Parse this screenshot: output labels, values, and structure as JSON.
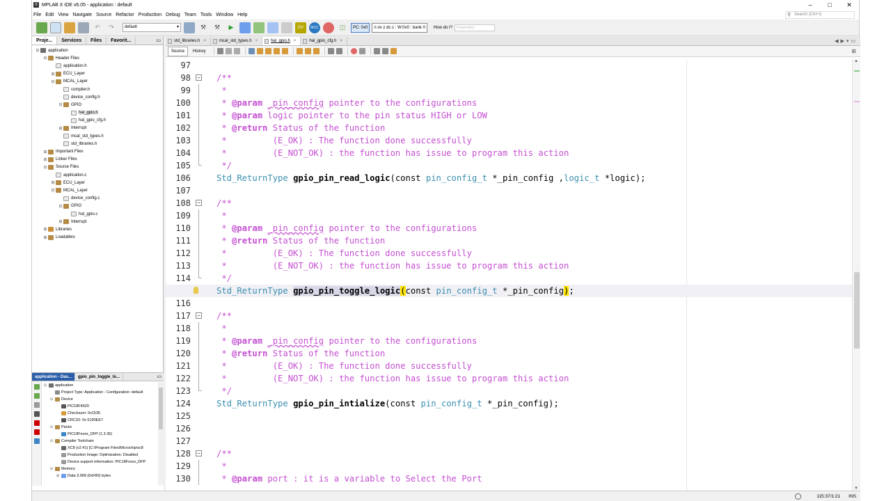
{
  "window": {
    "title": "MPLAB X IDE v6.05 - application : default",
    "controls": [
      "–",
      "□",
      "✕"
    ]
  },
  "menu": {
    "items": [
      "File",
      "Edit",
      "View",
      "Navigate",
      "Source",
      "Refactor",
      "Production",
      "Debug",
      "Team",
      "Tools",
      "Window",
      "Help"
    ],
    "search_placeholder": "Search (Ctrl+I)"
  },
  "toolbar": {
    "configuration": "default",
    "pc": "PC: 0x0",
    "status_bits": "n ov z dc c : W:0x0 : bank 0",
    "how_do_i": "How do I?",
    "keyword_placeholder": "Keyword(s)"
  },
  "left_panel": {
    "tabs": [
      "Proje...",
      "Services",
      "Files",
      "Favorit..."
    ],
    "tree": [
      {
        "depth": 0,
        "toggle": "⊟",
        "icon": "proj",
        "label": "application"
      },
      {
        "depth": 1,
        "toggle": "⊟",
        "icon": "folder",
        "label": "Header Files"
      },
      {
        "depth": 2,
        "toggle": "",
        "icon": "file-h",
        "label": "application.h"
      },
      {
        "depth": 2,
        "toggle": "⊞",
        "icon": "folder",
        "label": "ECU_Layer"
      },
      {
        "depth": 2,
        "toggle": "⊟",
        "icon": "folder",
        "label": "MCAL_Layer"
      },
      {
        "depth": 3,
        "toggle": "",
        "icon": "file-h",
        "label": "compiler.h"
      },
      {
        "depth": 3,
        "toggle": "",
        "icon": "file-h",
        "label": "device_config.h"
      },
      {
        "depth": 3,
        "toggle": "⊟",
        "icon": "folder",
        "label": "GPIO"
      },
      {
        "depth": 4,
        "toggle": "",
        "icon": "file-h",
        "label": "hal_gpio.h",
        "selected": true
      },
      {
        "depth": 4,
        "toggle": "",
        "icon": "file-h",
        "label": "hal_gpio_cfg.h"
      },
      {
        "depth": 3,
        "toggle": "⊞",
        "icon": "folder",
        "label": "Interrupt"
      },
      {
        "depth": 3,
        "toggle": "",
        "icon": "file-h",
        "label": "mcal_std_types.h"
      },
      {
        "depth": 3,
        "toggle": "",
        "icon": "file-h",
        "label": "std_libraries.h"
      },
      {
        "depth": 1,
        "toggle": "⊞",
        "icon": "folder",
        "label": "Important Files"
      },
      {
        "depth": 1,
        "toggle": "⊞",
        "icon": "folder",
        "label": "Linker Files"
      },
      {
        "depth": 1,
        "toggle": "⊟",
        "icon": "folder",
        "label": "Source Files"
      },
      {
        "depth": 2,
        "toggle": "",
        "icon": "file-c",
        "label": "application.c"
      },
      {
        "depth": 2,
        "toggle": "⊞",
        "icon": "folder",
        "label": "ECU_Layer"
      },
      {
        "depth": 2,
        "toggle": "⊟",
        "icon": "folder",
        "label": "MCAL_Layer"
      },
      {
        "depth": 3,
        "toggle": "",
        "icon": "file-c",
        "label": "device_config.c"
      },
      {
        "depth": 3,
        "toggle": "⊟",
        "icon": "folder",
        "label": "GPIO"
      },
      {
        "depth": 4,
        "toggle": "",
        "icon": "file-c",
        "label": "hal_gpio.c"
      },
      {
        "depth": 3,
        "toggle": "⊞",
        "icon": "folder",
        "label": "Interrupt"
      },
      {
        "depth": 1,
        "toggle": "⊞",
        "icon": "lib",
        "label": "Libraries"
      },
      {
        "depth": 1,
        "toggle": "⊞",
        "icon": "folder",
        "label": "Loadables"
      }
    ]
  },
  "dashboard": {
    "tabs": [
      "application - Das...",
      "gpio_pin_toggle_lo..."
    ],
    "rows": [
      {
        "depth": 0,
        "toggle": "⊟",
        "label": "application"
      },
      {
        "depth": 1,
        "toggle": "",
        "label": "Project Type: Application - Configuration: default"
      },
      {
        "depth": 1,
        "toggle": "⊟",
        "label": "Device"
      },
      {
        "depth": 2,
        "toggle": "",
        "label": "PIC18F4620"
      },
      {
        "depth": 2,
        "toggle": "",
        "label": "Checksum: 0x1535"
      },
      {
        "depth": 2,
        "toggle": "",
        "label": "CRC32: 0x 6190EE7"
      },
      {
        "depth": 1,
        "toggle": "⊟",
        "label": "Packs"
      },
      {
        "depth": 2,
        "toggle": "",
        "label": "PIC18Fxxxx_DFP (1.3.36)"
      },
      {
        "depth": 1,
        "toggle": "⊟",
        "label": "Compiler Toolchain"
      },
      {
        "depth": 2,
        "toggle": "",
        "label": "XC8 (v2.41) [C:\\Program Files\\Microchip\\xc8"
      },
      {
        "depth": 2,
        "toggle": "",
        "label": "Production Image: Optimization: Disabled"
      },
      {
        "depth": 2,
        "toggle": "",
        "label": "Device support information: PIC18Fxxxx_DFP"
      },
      {
        "depth": 1,
        "toggle": "⊟",
        "label": "Memory"
      },
      {
        "depth": 2,
        "toggle": "⊞",
        "label": "Data 3,968 (0xF80) bytes"
      }
    ]
  },
  "editor": {
    "file_tabs": [
      {
        "name": "std_libraries.h",
        "active": false
      },
      {
        "name": "mcal_std_types.h",
        "active": false
      },
      {
        "name": "hal_gpio.h",
        "active": true
      },
      {
        "name": "hal_gpio_cfg.h",
        "active": false
      }
    ],
    "source_label": "Source",
    "history_label": "History",
    "lines": [
      {
        "n": "97",
        "g": "",
        "t": []
      },
      {
        "n": "98",
        "g": "fold",
        "t": [
          [
            "cm",
            "/**"
          ]
        ]
      },
      {
        "n": "99",
        "g": "line",
        "t": [
          [
            "cm",
            " *"
          ]
        ]
      },
      {
        "n": "100",
        "g": "line",
        "t": [
          [
            "cm",
            " * "
          ],
          [
            "tag",
            "@param"
          ],
          [
            "cm",
            " "
          ],
          [
            "pn",
            "_pin_config"
          ],
          [
            "cm",
            " pointer to the configurations"
          ]
        ]
      },
      {
        "n": "101",
        "g": "line",
        "t": [
          [
            "cm",
            " * "
          ],
          [
            "tag",
            "@param"
          ],
          [
            "cm",
            " logic pointer to the pin status HIGH or LOW"
          ]
        ]
      },
      {
        "n": "102",
        "g": "line",
        "t": [
          [
            "cm",
            " * "
          ],
          [
            "tag",
            "@return"
          ],
          [
            "cm",
            " Status of the function"
          ]
        ]
      },
      {
        "n": "103",
        "g": "line",
        "t": [
          [
            "cm",
            " *         (E_OK) : The function done successfully"
          ]
        ]
      },
      {
        "n": "104",
        "g": "line",
        "t": [
          [
            "cm",
            " *         (E_NOT_OK) : the function has issue to program this action"
          ]
        ]
      },
      {
        "n": "105",
        "g": "end",
        "t": [
          [
            "cm",
            " */"
          ]
        ]
      },
      {
        "n": "106",
        "g": "",
        "t": [
          [
            "ty",
            "Std_ReturnType"
          ],
          [
            "pl",
            " "
          ],
          [
            "fn",
            "gpio_pin_read_logic"
          ],
          [
            "pl",
            "(const "
          ],
          [
            "ty",
            "pin_config_t"
          ],
          [
            "pl",
            " *_pin_config ,"
          ],
          [
            "ty",
            "logic_t"
          ],
          [
            "pl",
            " *logic);"
          ]
        ]
      },
      {
        "n": "107",
        "g": "",
        "t": []
      },
      {
        "n": "108",
        "g": "fold",
        "t": [
          [
            "cm",
            "/**"
          ]
        ]
      },
      {
        "n": "109",
        "g": "line",
        "t": [
          [
            "cm",
            " *"
          ]
        ]
      },
      {
        "n": "110",
        "g": "line",
        "t": [
          [
            "cm",
            " * "
          ],
          [
            "tag",
            "@param"
          ],
          [
            "cm",
            " "
          ],
          [
            "pn",
            "_pin_config"
          ],
          [
            "cm",
            " pointer to the configurations"
          ]
        ]
      },
      {
        "n": "111",
        "g": "line",
        "t": [
          [
            "cm",
            " * "
          ],
          [
            "tag",
            "@return"
          ],
          [
            "cm",
            " Status of the function"
          ]
        ]
      },
      {
        "n": "112",
        "g": "line",
        "t": [
          [
            "cm",
            " *         (E_OK) : The function done successfully"
          ]
        ]
      },
      {
        "n": "113",
        "g": "line",
        "t": [
          [
            "cm",
            " *         (E_NOT_OK) : the function has issue to program this action"
          ]
        ]
      },
      {
        "n": "114",
        "g": "end",
        "t": [
          [
            "cm",
            " */"
          ]
        ]
      },
      {
        "n": "",
        "g": "bulb",
        "current": true,
        "t": [
          [
            "ty",
            "Std_ReturnType"
          ],
          [
            "pl",
            " "
          ],
          [
            "fn hl",
            "gpio_pin_toggle_logic"
          ],
          [
            "bm",
            "("
          ],
          [
            "pl",
            "const "
          ],
          [
            "ty",
            "pin_config_t"
          ],
          [
            "pl",
            " *_pin_config"
          ],
          [
            "bm",
            ")"
          ],
          [
            "pl",
            ";"
          ]
        ]
      },
      {
        "n": "116",
        "g": "",
        "t": []
      },
      {
        "n": "117",
        "g": "fold",
        "t": [
          [
            "cm",
            "/**"
          ]
        ]
      },
      {
        "n": "118",
        "g": "line",
        "t": [
          [
            "cm",
            " *"
          ]
        ]
      },
      {
        "n": "119",
        "g": "line",
        "t": [
          [
            "cm",
            " * "
          ],
          [
            "tag",
            "@param"
          ],
          [
            "cm",
            " "
          ],
          [
            "pn",
            "_pin_config"
          ],
          [
            "cm",
            " pointer to the configurations"
          ]
        ]
      },
      {
        "n": "120",
        "g": "line",
        "t": [
          [
            "cm",
            " * "
          ],
          [
            "tag",
            "@return"
          ],
          [
            "cm",
            " Status of the function"
          ]
        ]
      },
      {
        "n": "121",
        "g": "line",
        "t": [
          [
            "cm",
            " *         (E_OK) : The function done successfully"
          ]
        ]
      },
      {
        "n": "122",
        "g": "line",
        "t": [
          [
            "cm",
            " *         (E_NOT_OK) : the function has issue to program this action"
          ]
        ]
      },
      {
        "n": "123",
        "g": "end",
        "t": [
          [
            "cm",
            " */"
          ]
        ]
      },
      {
        "n": "124",
        "g": "",
        "t": [
          [
            "ty",
            "Std_ReturnType"
          ],
          [
            "pl",
            " "
          ],
          [
            "fn",
            "gpio_pin_intialize"
          ],
          [
            "pl",
            "(const "
          ],
          [
            "ty",
            "pin_config_t"
          ],
          [
            "pl",
            " *_pin_config);"
          ]
        ]
      },
      {
        "n": "125",
        "g": "",
        "t": []
      },
      {
        "n": "126",
        "g": "",
        "t": []
      },
      {
        "n": "127",
        "g": "",
        "t": []
      },
      {
        "n": "128",
        "g": "fold",
        "t": [
          [
            "cm",
            "/**"
          ]
        ]
      },
      {
        "n": "129",
        "g": "line",
        "t": [
          [
            "cm",
            " *"
          ]
        ]
      },
      {
        "n": "130",
        "g": "line",
        "t": [
          [
            "cm",
            " * "
          ],
          [
            "tag",
            "@param"
          ],
          [
            "cm",
            " port : it is a variable to Select the Port"
          ]
        ]
      }
    ]
  },
  "status": {
    "position": "115:37/1:21",
    "mode": "INS"
  },
  "colors": {
    "comment": "#c44fd1",
    "type": "#3a8fb0",
    "accent": "#2b5ea8",
    "brace_match": "#ffe600"
  }
}
